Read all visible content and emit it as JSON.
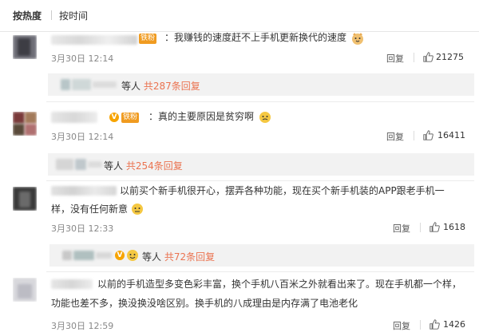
{
  "tabs": {
    "hot": "按热度",
    "time": "按时间"
  },
  "comments": [
    {
      "text": "：我赚钱的速度赶不上手机更新换代的速度",
      "badge": "铁粉",
      "date": "3月30日 12:14",
      "reply": "回复",
      "likes": "21275",
      "sub": {
        "prefix": "等人",
        "count": "共287条回复"
      }
    },
    {
      "text": "：真的主要原因是贫穷啊",
      "badge": "铁粉",
      "date": "3月30日 12:14",
      "reply": "回复",
      "likes": "16411",
      "sub": {
        "prefix": "等人",
        "count": "共254条回复"
      }
    },
    {
      "line1": "以前买个新手机很开心，摆弄各种功能，现在买个新手机装的APP跟老手机一",
      "line2": "样，没有任何新意",
      "date": "3月30日 12:33",
      "reply": "回复",
      "likes": "1618",
      "sub": {
        "prefix": "等人",
        "count": "共72条回复"
      }
    },
    {
      "line1": "以前的手机造型多变色彩丰富，换个手机八百米之外就看出来了。现在手机都一个样，",
      "line2": "功能也差不多，换没换没啥区别。换手机的八成理由是内存满了电池老化",
      "date": "3月30日 12:59",
      "reply": "回复",
      "likes": "1426"
    }
  ],
  "icons": {
    "thumb": "thumbs-up-icon",
    "verified": "verified-v-icon",
    "emoji": "emoji-icon"
  },
  "colors": {
    "reply_count": "#eb7350",
    "badge": "#f09b20",
    "verified": "#f7a400"
  }
}
